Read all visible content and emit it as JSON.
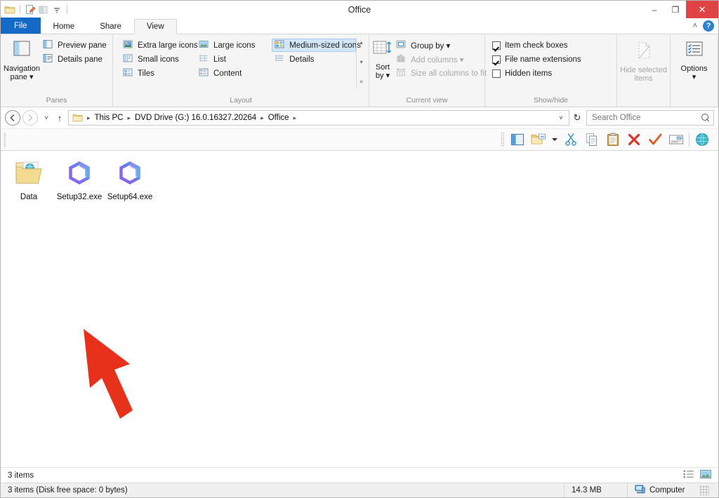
{
  "window": {
    "title": "Office",
    "minimize_label": "–",
    "maximize_label": "❐",
    "close_label": "✕"
  },
  "quick_access": {
    "items": [
      {
        "name": "folder-icon",
        "label": "Folder"
      },
      {
        "name": "properties-icon",
        "label": "Properties"
      },
      {
        "name": "new-folder-icon",
        "label": "New folder"
      },
      {
        "name": "customize-dropdown-icon",
        "label": "Customize Quick Access Toolbar"
      }
    ]
  },
  "tabs": [
    {
      "label": "File",
      "id": "file"
    },
    {
      "label": "Home",
      "id": "home"
    },
    {
      "label": "Share",
      "id": "share"
    },
    {
      "label": "View",
      "id": "view"
    }
  ],
  "tab_controls": {
    "collapse_label": "˄",
    "help_label": "?"
  },
  "ribbon": {
    "groups": [
      {
        "label": "Panes",
        "big_button": {
          "label_line1": "Navigation",
          "label_line2": "pane ▾",
          "icon": "navigation-pane-icon"
        },
        "items": [
          {
            "label": "Preview pane",
            "icon": "preview-pane-icon",
            "disabled": false
          },
          {
            "label": "Details pane",
            "icon": "details-pane-icon",
            "disabled": false
          }
        ]
      },
      {
        "label": "Layout",
        "columns": [
          [
            {
              "label": "Extra large icons",
              "icon": "extra-large-icons-icon",
              "selected": false
            },
            {
              "label": "Small icons",
              "icon": "small-icons-icon",
              "selected": false
            },
            {
              "label": "Tiles",
              "icon": "tiles-icon",
              "selected": false
            }
          ],
          [
            {
              "label": "Large icons",
              "icon": "large-icons-icon",
              "selected": false
            },
            {
              "label": "List",
              "icon": "list-icon",
              "selected": false
            },
            {
              "label": "Content",
              "icon": "content-icon",
              "selected": false
            }
          ],
          [
            {
              "label": "Medium-sized icons",
              "icon": "medium-icons-icon",
              "selected": true
            },
            {
              "label": "Details",
              "icon": "details-view-icon",
              "selected": false
            }
          ]
        ],
        "scroll": {
          "up": "▴",
          "down": "▾",
          "more": "≡"
        }
      },
      {
        "label": "Current view",
        "big_button": {
          "label_line1": "Sort",
          "label_line2": "by ▾",
          "icon": "sort-by-icon"
        },
        "items": [
          {
            "label": "Group by ▾",
            "icon": "group-by-icon",
            "disabled": false
          },
          {
            "label": "Add columns ▾",
            "icon": "add-columns-icon",
            "disabled": true
          },
          {
            "label": "Size all columns to fit",
            "icon": "size-columns-icon",
            "disabled": true
          }
        ]
      },
      {
        "label": "Show/hide",
        "checkboxes": [
          {
            "label": "Item check boxes",
            "checked": true
          },
          {
            "label": "File name extensions",
            "checked": true
          },
          {
            "label": "Hidden items",
            "checked": false
          }
        ],
        "hide_selected": {
          "label_line1": "Hide selected",
          "label_line2": "items",
          "icon": "hide-selected-items-icon",
          "disabled": true
        }
      },
      {
        "label": "",
        "options_button": {
          "label_line1": "Options",
          "label_line2": "▾",
          "icon": "options-icon"
        }
      }
    ]
  },
  "address_bar": {
    "back_label": "←",
    "forward_label": "→",
    "recent_label": "˅",
    "up_label": "↑",
    "breadcrumb": [
      {
        "label": "This PC"
      },
      {
        "label": "DVD Drive (G:) 16.0.16327.20264"
      },
      {
        "label": "Office"
      }
    ],
    "breadcrumb_sep": "▸",
    "dropdown_label": "˅",
    "refresh_label": "↻"
  },
  "search": {
    "placeholder": "Search Office",
    "icon": "search-icon"
  },
  "toolbar": {
    "buttons": [
      {
        "name": "navigation-panel-button",
        "label": "Panel"
      },
      {
        "name": "open-folder-button",
        "label": "Open folder"
      },
      {
        "name": "toolbar-dropdown-button",
        "label": "▾"
      },
      {
        "name": "cut-button",
        "label": "Cut"
      },
      {
        "name": "copy-button",
        "label": "Copy"
      },
      {
        "name": "paste-button",
        "label": "Paste"
      },
      {
        "name": "delete-button",
        "label": "Delete"
      },
      {
        "name": "confirm-button",
        "label": "Confirm"
      },
      {
        "name": "rename-button",
        "label": "Rename"
      },
      {
        "name": "browser-button",
        "label": "Browser"
      }
    ]
  },
  "files": [
    {
      "name": "Data",
      "type": "folder",
      "icon": "folder-documents-icon"
    },
    {
      "name": "Setup32.exe",
      "type": "executable",
      "icon": "office-logo-icon"
    },
    {
      "name": "Setup64.exe",
      "type": "executable",
      "icon": "office-logo-icon"
    }
  ],
  "annotation": {
    "type": "arrow",
    "color": "#e8311a",
    "points_to": "Setup32.exe"
  },
  "status": {
    "item_count": "3 items",
    "details_view_label": "Details view",
    "large_icons_view_label": "Large icons view",
    "full_status": "3 items (Disk free space: 0 bytes)",
    "size": "14.3 MB",
    "location": "Computer",
    "location_icon": "computer-icon"
  },
  "colors": {
    "file_tab_blue": "#1569c7",
    "close_red": "#e04343",
    "selection_blue": "#d3e6f7",
    "annotation_red": "#e8311a",
    "office_purple": "#8b5cf6",
    "office_blue": "#39a9e0"
  }
}
